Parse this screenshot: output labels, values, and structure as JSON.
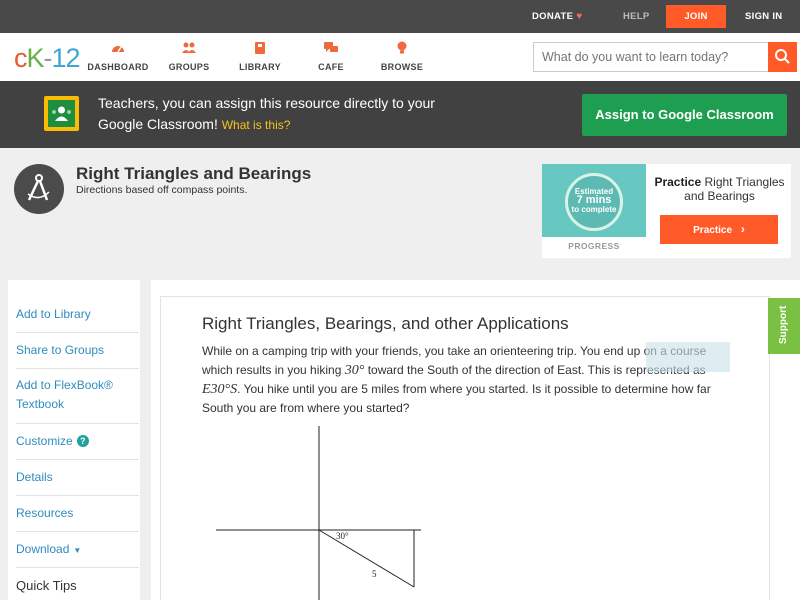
{
  "topbar": {
    "donate": "DONATE",
    "help": "HELP",
    "join": "JOIN",
    "signin": "SIGN IN"
  },
  "nav": {
    "logo_c": "c",
    "logo_k": "K",
    "logo_dash": "-",
    "logo_num": "12",
    "items": [
      {
        "label": "DASHBOARD",
        "icon": "dashboard-icon"
      },
      {
        "label": "GROUPS",
        "icon": "groups-icon"
      },
      {
        "label": "LIBRARY",
        "icon": "library-icon"
      },
      {
        "label": "CAFE",
        "icon": "cafe-icon"
      },
      {
        "label": "BROWSE",
        "icon": "browse-icon"
      }
    ],
    "search_placeholder": "What do you want to learn today?"
  },
  "banner": {
    "text": "Teachers, you can assign this resource directly to your Google Classroom!",
    "what_link": "What is this?",
    "assign_button": "Assign to Google Classroom"
  },
  "header": {
    "title": "Right Triangles and Bearings",
    "subtitle": "Directions based off compass points."
  },
  "practice": {
    "estimated": "Estimated",
    "mins": "7 mins",
    "to_complete": "to complete",
    "progress_label": "PROGRESS",
    "heading_bold": "Practice",
    "heading_rest": "Right Triangles and Bearings",
    "button": "Practice"
  },
  "sidebar": {
    "items": [
      {
        "label": "Add to Library"
      },
      {
        "label": "Share to Groups"
      },
      {
        "label": "Add to FlexBook® Textbook"
      },
      {
        "label": "Customize"
      },
      {
        "label": "Details"
      },
      {
        "label": "Resources"
      },
      {
        "label": "Download"
      },
      {
        "label": "Quick Tips"
      }
    ]
  },
  "content": {
    "title": "Right Triangles, Bearings, and other Applications",
    "p1": "While on a camping trip with your friends, you take an orienteering trip. You end up on a course which results in you hiking",
    "angle": "30°",
    "p2": "toward the South of the direction of East. This is represented as",
    "bearing": "E30°S",
    "p3": ". You hike until you are 5 miles from where you started. Is it possible to determine how far South you are from where you started?",
    "diagram_angle": "30°",
    "diagram_side": "5"
  },
  "support": "Support",
  "colors": {
    "accent_orange": "#ff5a28",
    "google_green": "#1e9e50",
    "link_blue": "#2f8bbf",
    "support_green": "#7ac143"
  }
}
